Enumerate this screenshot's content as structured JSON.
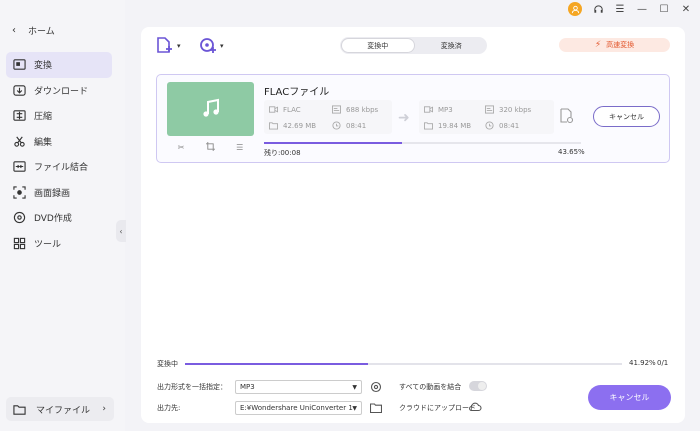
{
  "sidebar": {
    "home_label": "ホーム",
    "items": [
      {
        "label": "変換",
        "icon": "convert-icon",
        "active": true
      },
      {
        "label": "ダウンロード",
        "icon": "download-icon",
        "active": false
      },
      {
        "label": "圧縮",
        "icon": "compress-icon",
        "active": false
      },
      {
        "label": "編集",
        "icon": "scissors-icon",
        "active": false
      },
      {
        "label": "ファイル結合",
        "icon": "merge-icon",
        "active": false
      },
      {
        "label": "画面録画",
        "icon": "record-icon",
        "active": false
      },
      {
        "label": "DVD作成",
        "icon": "dvd-icon",
        "active": false
      },
      {
        "label": "ツール",
        "icon": "tools-icon",
        "active": false
      }
    ],
    "my_files_label": "マイファイル"
  },
  "tabs": {
    "converting": "変換中",
    "converted": "変換済"
  },
  "fast_convert_label": "高速変換",
  "file": {
    "name": "FLACファイル",
    "source": {
      "format": "FLAC",
      "bitrate": "688 kbps",
      "size": "42.69 MB",
      "duration": "08:41"
    },
    "target": {
      "format": "MP3",
      "bitrate": "320 kbps",
      "size": "19.84 MB",
      "duration": "08:41"
    },
    "cancel_label": "キャンセル",
    "remaining": "残り:00:08",
    "percent_text": "43.65%",
    "percent": 43.65
  },
  "total": {
    "label": "変換中",
    "percent_text": "41.92%",
    "percent": 41.92,
    "count": "0/1"
  },
  "output": {
    "format_label": "出力形式を一括指定：",
    "format_value": "MP3",
    "dest_label": "出力先:",
    "dest_value": "E:¥Wondershare UniConverter 1",
    "merge_label": "すべての動画を結合",
    "cloud_label": "クラウドにアップロード",
    "cancel_label": "キャンセル"
  },
  "colors": {
    "accent": "#7a5ce0",
    "fast": "#e2552b",
    "thumb": "#8ecaa4"
  }
}
